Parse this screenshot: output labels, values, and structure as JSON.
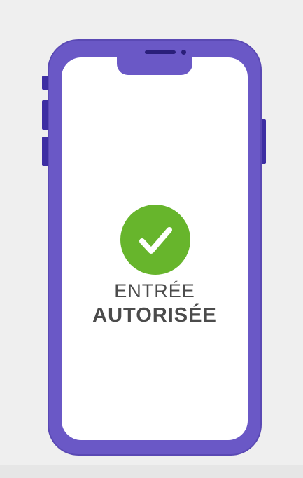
{
  "screen": {
    "icon": "checkmark-icon",
    "status_line1": "ENTRÉE",
    "status_line2": "AUTORISÉE"
  },
  "colors": {
    "phone_frame": "#6a58c6",
    "side_buttons": "#3d2ea3",
    "success_green": "#67b52c",
    "text": "#4b4b4b",
    "background": "#efefef"
  }
}
